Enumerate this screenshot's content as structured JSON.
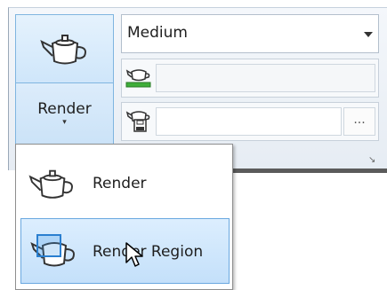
{
  "render_button": {
    "label": "Render",
    "arrow": "▾",
    "icon": "teapot-icon"
  },
  "quality_dropdown": {
    "value": "Medium"
  },
  "progress_row": {
    "icon": "teapot-progress-icon"
  },
  "output_row": {
    "icon": "teapot-save-icon",
    "browse_label": "..."
  },
  "panel": {
    "launcher_glyph": "↘"
  },
  "menu": {
    "items": [
      {
        "label": "Render",
        "icon": "teapot-icon"
      },
      {
        "label": "Render Region",
        "icon": "render-region-icon"
      }
    ]
  },
  "colors": {
    "highlight_fill": "#cfe6fa",
    "highlight_border": "#7fb5e0",
    "progress_green": "#3fae3a"
  }
}
